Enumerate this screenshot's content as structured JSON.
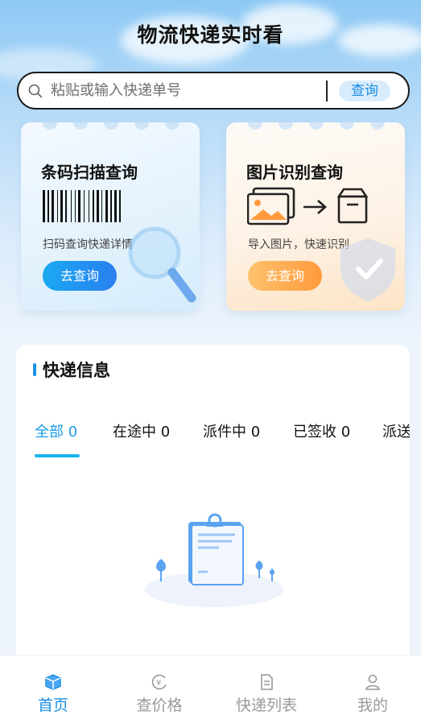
{
  "header": {
    "title": "物流快递实时看"
  },
  "search": {
    "placeholder": "粘贴或输入快递单号",
    "button_label": "查询"
  },
  "cards": [
    {
      "title": "条码扫描查询",
      "subtitle": "扫码查询快递详情",
      "button_label": "去查询",
      "icon": "barcode-icon",
      "accent": "#2a8ff0"
    },
    {
      "title": "图片识别查询",
      "subtitle": "导入图片，快速识别",
      "button_label": "去查询",
      "icon": "image-to-box-icon",
      "accent": "#ffa445"
    }
  ],
  "info": {
    "title": "快递信息",
    "tabs": [
      {
        "label": "全部",
        "count": "0",
        "active": true
      },
      {
        "label": "在途中",
        "count": "0",
        "active": false
      },
      {
        "label": "派件中",
        "count": "0",
        "active": false
      },
      {
        "label": "已签收",
        "count": "0",
        "active": false
      },
      {
        "label": "派送",
        "count": "",
        "active": false
      }
    ],
    "empty_icon": "empty-clipboard-icon"
  },
  "nav": {
    "items": [
      {
        "label": "首页",
        "icon": "package-icon",
        "active": true
      },
      {
        "label": "查价格",
        "icon": "price-icon",
        "active": false
      },
      {
        "label": "快递列表",
        "icon": "list-icon",
        "active": false
      },
      {
        "label": "我的",
        "icon": "user-icon",
        "active": false
      }
    ]
  },
  "colors": {
    "accent": "#1a8fe3",
    "tab_active": "#1a9ee8",
    "orange": "#ff9a3c"
  }
}
